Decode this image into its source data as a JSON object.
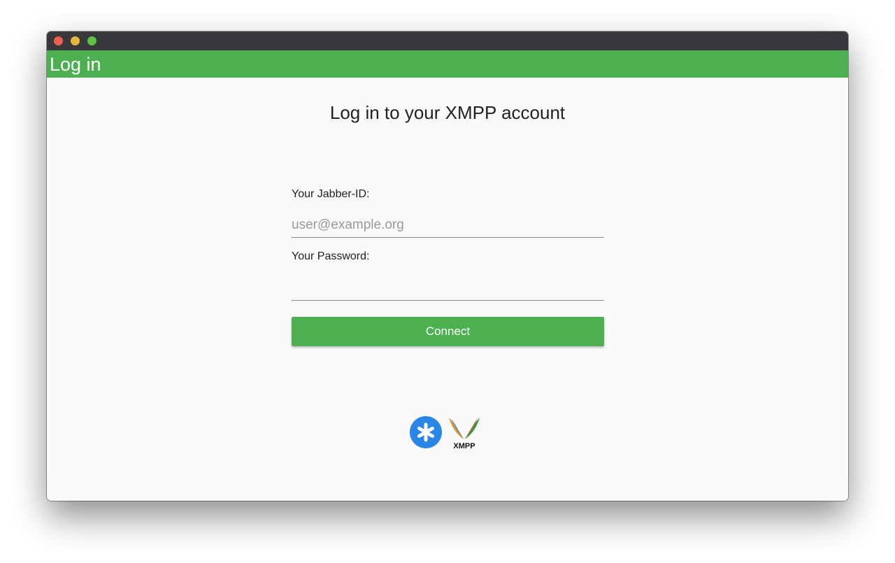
{
  "appbar": {
    "title": "Log in"
  },
  "main": {
    "heading": "Log in to your XMPP account",
    "jid_label": "Your Jabber-ID:",
    "jid_placeholder": "user@example.org",
    "jid_value": "",
    "password_label": "Your Password:",
    "password_value": "",
    "connect_label": "Connect"
  },
  "logos": {
    "star_icon": "asterisk-icon",
    "xmpp_logo_text": "XMPP"
  },
  "colors": {
    "accent": "#4caf50",
    "titlebar": "#39393d",
    "background": "#f9f9f9",
    "logo_blue": "#2a86e6"
  }
}
